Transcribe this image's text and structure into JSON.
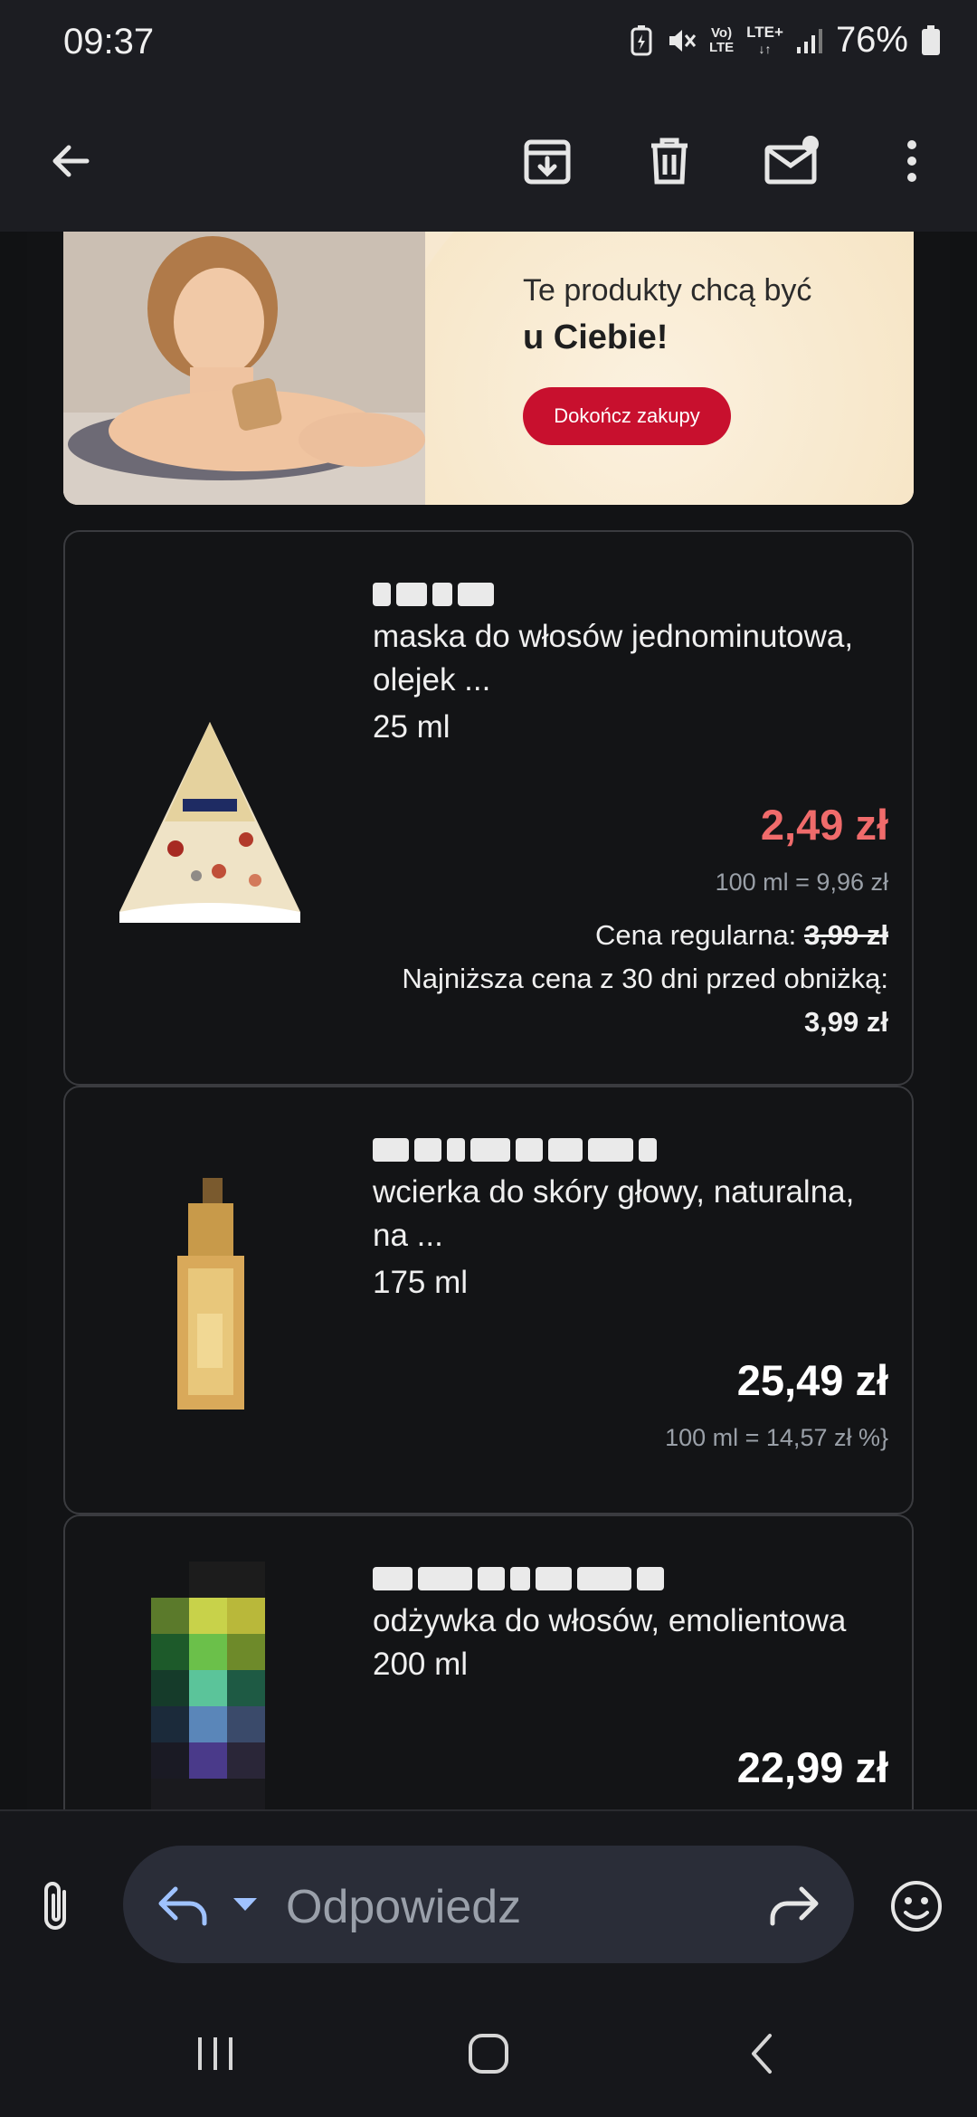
{
  "status_bar": {
    "time": "09:37",
    "battery": "76%",
    "network_label_1": "Vo)",
    "network_label_2": "LTE",
    "network_label_3": "LTE+"
  },
  "toolbar": {
    "back_icon": "arrow-left-icon",
    "archive_icon": "archive-download-icon",
    "delete_icon": "trash-icon",
    "mark_unread_icon": "mail-unread-icon",
    "more_icon": "more-vert-icon"
  },
  "banner": {
    "line1": "Te produkty chcą być",
    "line2": "u Ciebie!",
    "cta_label": "Dokończ zakupy",
    "cta_color": "#c8102e"
  },
  "products": [
    {
      "name": "maska do włosów jednominutowa, olejek ...",
      "size": "25 ml",
      "price": "2,49 zł",
      "price_color": "#f06b6b",
      "unit_price": "100 ml = 9,96 zł",
      "regular_label": "Cena regularna:",
      "regular_price": "3,99 zł",
      "lowest_label": "Najniższa cena z 30 dni przed obniżką:",
      "lowest_price": "3,99 zł"
    },
    {
      "name": "wcierka do skóry głowy, naturalna, na ...",
      "size": "175 ml",
      "price": "25,49 zł",
      "price_color": "#ffffff",
      "unit_price": "100 ml = 14,57 zł %}"
    },
    {
      "name": "odżywka do włosów, emolientowa",
      "size": "200 ml",
      "price": "22,99 zł",
      "price_color": "#ffffff"
    }
  ],
  "reply_bar": {
    "placeholder": "Odpowiedz",
    "attach_icon": "paperclip-icon",
    "reply_icon": "reply-icon",
    "forward_icon": "forward-icon",
    "emoji_icon": "emoji-icon"
  },
  "nav_bar": {
    "recents_icon": "recents-icon",
    "home_icon": "home-icon",
    "back_icon": "nav-back-icon"
  }
}
